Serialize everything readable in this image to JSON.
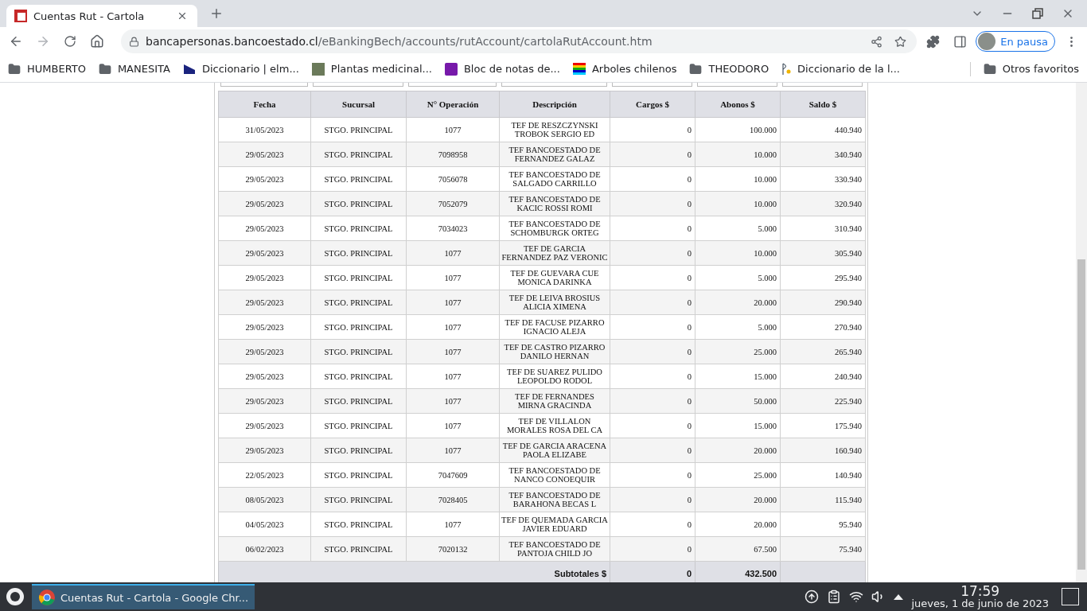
{
  "browser": {
    "tab_title": "Cuentas Rut - Cartola",
    "url_host": "bancapersonas.bancoestado.cl",
    "url_path": "/eBankingBech/accounts/rutAccount/cartolaRutAccount.htm",
    "profile_label": "En pausa",
    "bookmarks": [
      {
        "label": "HUMBERTO",
        "kind": "folder"
      },
      {
        "label": "MANESITA",
        "kind": "folder"
      },
      {
        "label": "Diccionario | elm...",
        "kind": "site"
      },
      {
        "label": "Plantas medicinal...",
        "kind": "photo"
      },
      {
        "label": "Bloc de notas de...",
        "kind": "notes"
      },
      {
        "label": "Arboles chilenos",
        "kind": "stripes"
      },
      {
        "label": "THEODORO",
        "kind": "folder"
      },
      {
        "label": "Diccionario de la l...",
        "kind": "letter"
      }
    ],
    "other_bookmarks": "Otros favoritos"
  },
  "table": {
    "columns": [
      "Fecha",
      "Sucursal",
      "N° Operación",
      "Descripción",
      "Cargos $",
      "Abonos $",
      "Saldo $"
    ],
    "rows": [
      [
        "31/05/2023",
        "STGO. PRINCIPAL",
        "1077",
        "TEF DE RESZCZYNSKI TROBOK SERGIO ED",
        "0",
        "100.000",
        "440.940"
      ],
      [
        "29/05/2023",
        "STGO. PRINCIPAL",
        "7098958",
        "TEF BANCOESTADO DE FERNANDEZ GALAZ",
        "0",
        "10.000",
        "340.940"
      ],
      [
        "29/05/2023",
        "STGO. PRINCIPAL",
        "7056078",
        "TEF BANCOESTADO DE SALGADO CARRILLO",
        "0",
        "10.000",
        "330.940"
      ],
      [
        "29/05/2023",
        "STGO. PRINCIPAL",
        "7052079",
        "TEF BANCOESTADO DE KACIC ROSSI ROMI",
        "0",
        "10.000",
        "320.940"
      ],
      [
        "29/05/2023",
        "STGO. PRINCIPAL",
        "7034023",
        "TEF BANCOESTADO DE SCHOMBURGK ORTEG",
        "0",
        "5.000",
        "310.940"
      ],
      [
        "29/05/2023",
        "STGO. PRINCIPAL",
        "1077",
        "TEF DE GARCIA FERNANDEZ PAZ VERONIC",
        "0",
        "10.000",
        "305.940"
      ],
      [
        "29/05/2023",
        "STGO. PRINCIPAL",
        "1077",
        "TEF DE GUEVARA CUE MONICA DARINKA",
        "0",
        "5.000",
        "295.940"
      ],
      [
        "29/05/2023",
        "STGO. PRINCIPAL",
        "1077",
        "TEF DE LEIVA BROSIUS ALICIA XIMENA",
        "0",
        "20.000",
        "290.940"
      ],
      [
        "29/05/2023",
        "STGO. PRINCIPAL",
        "1077",
        "TEF DE FACUSE PIZARRO IGNACIO ALEJA",
        "0",
        "5.000",
        "270.940"
      ],
      [
        "29/05/2023",
        "STGO. PRINCIPAL",
        "1077",
        "TEF DE CASTRO PIZARRO DANILO HERNAN",
        "0",
        "25.000",
        "265.940"
      ],
      [
        "29/05/2023",
        "STGO. PRINCIPAL",
        "1077",
        "TEF DE SUAREZ PULIDO LEOPOLDO RODOL",
        "0",
        "15.000",
        "240.940"
      ],
      [
        "29/05/2023",
        "STGO. PRINCIPAL",
        "1077",
        "TEF DE FERNANDES MIRNA GRACINDA",
        "0",
        "50.000",
        "225.940"
      ],
      [
        "29/05/2023",
        "STGO. PRINCIPAL",
        "1077",
        "TEF DE VILLALON MORALES ROSA DEL CA",
        "0",
        "15.000",
        "175.940"
      ],
      [
        "29/05/2023",
        "STGO. PRINCIPAL",
        "1077",
        "TEF DE GARCIA ARACENA PAOLA ELIZABE",
        "0",
        "20.000",
        "160.940"
      ],
      [
        "22/05/2023",
        "STGO. PRINCIPAL",
        "7047609",
        "TEF BANCOESTADO DE NANCO CONOEQUIR",
        "0",
        "25.000",
        "140.940"
      ],
      [
        "08/05/2023",
        "STGO. PRINCIPAL",
        "7028405",
        "TEF BANCOESTADO DE BARAHONA BECAS L",
        "0",
        "20.000",
        "115.940"
      ],
      [
        "04/05/2023",
        "STGO. PRINCIPAL",
        "1077",
        "TEF DE QUEMADA GARCIA JAVIER EDUARD",
        "0",
        "20.000",
        "95.940"
      ],
      [
        "06/02/2023",
        "STGO. PRINCIPAL",
        "7020132",
        "TEF BANCOESTADO DE PANTOJA CHILD JO",
        "0",
        "67.500",
        "75.940"
      ]
    ],
    "subtotal": {
      "label": "Subtotales $",
      "cargos": "0",
      "abonos": "432.500"
    }
  },
  "taskbar": {
    "task_title": "Cuentas Rut - Cartola - Google Chr...",
    "time": "17:59",
    "date": "jueves, 1 de junio de 2023"
  }
}
